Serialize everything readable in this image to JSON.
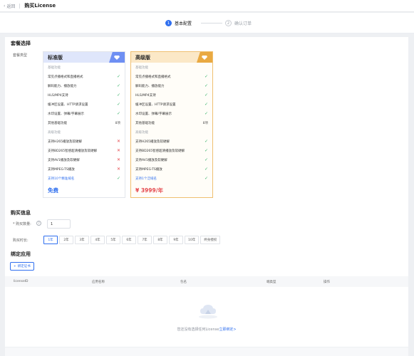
{
  "header": {
    "back": "返回",
    "title": "购买License"
  },
  "steps": [
    {
      "num": "1",
      "label": "基本配置"
    },
    {
      "num": "2",
      "label": "确认订单"
    }
  ],
  "package": {
    "section_title": "套餐选择",
    "type_label": "套餐类型",
    "cards": [
      {
        "name": "标准版",
        "features": [
          {
            "text": "基础功能",
            "group": true
          },
          {
            "text": "常见点播格式和直播格式",
            "mark": "check"
          },
          {
            "text": "解码能力、播放能力",
            "mark": "check"
          },
          {
            "text": "HLS/MP4支持",
            "mark": "check"
          },
          {
            "text": "缓冲区设置、HTTP请求设置",
            "mark": "check"
          },
          {
            "text": "水印设置、弹幕/字幕展示",
            "mark": "check"
          },
          {
            "text": "其他基础功能",
            "mark": "count",
            "count": "8项"
          },
          {
            "text": "高级功能",
            "group": true
          },
          {
            "text": "支持H265播放及软硬解",
            "mark": "cross"
          },
          {
            "text": "支持BD265智感超清播放及软硬解",
            "mark": "cross"
          },
          {
            "text": "支持AV1播放及软硬解",
            "mark": "cross"
          },
          {
            "text": "支持MPEG-TS播放",
            "mark": "cross"
          },
          {
            "text": "支持10个精准域名",
            "mark": "check",
            "domain": true
          }
        ],
        "price": "免费"
      },
      {
        "name": "高级版",
        "features": [
          {
            "text": "基础功能",
            "group": true
          },
          {
            "text": "常见点播格式和直播格式",
            "mark": "check"
          },
          {
            "text": "解码能力、播放能力",
            "mark": "check"
          },
          {
            "text": "HLS/MP4支持",
            "mark": "check"
          },
          {
            "text": "缓冲区设置、HTTP请求设置",
            "mark": "check"
          },
          {
            "text": "水印设置、弹幕/字幕展示",
            "mark": "check"
          },
          {
            "text": "其他基础功能",
            "mark": "count",
            "count": "8项"
          },
          {
            "text": "高级功能",
            "group": true
          },
          {
            "text": "支持H265播放及软硬解",
            "mark": "check"
          },
          {
            "text": "支持BD265智感超清播放及软硬解",
            "mark": "check"
          },
          {
            "text": "支持AV1播放及软硬解",
            "mark": "check"
          },
          {
            "text": "支持MPEG-TS播放",
            "mark": "check"
          },
          {
            "text": "支持1个泛域名",
            "mark": "check",
            "domain": true
          }
        ],
        "price": "¥ 3999/年"
      }
    ]
  },
  "purchase": {
    "section_title": "购买信息",
    "qty_label": "* 购买数量:",
    "qty_value": "1",
    "period_label": "购买时长:",
    "periods": [
      "1年",
      "2年",
      "3年",
      "4年",
      "5年",
      "6年",
      "7年",
      "8年",
      "9年",
      "10年",
      "终身授权"
    ],
    "selected_period": 0
  },
  "binding": {
    "section_title": "绑定应用",
    "bind_button": "绑定证书",
    "columns": [
      "licenseID",
      "应用名称",
      "包名",
      "端类型",
      "操作"
    ],
    "empty_text": "您还没有选择任何License",
    "empty_link": "立即绑定>"
  },
  "colors": {
    "accent": "#2f6fef",
    "check": "#3bb36b",
    "cross": "#e5484d",
    "premium": "#e9a942"
  }
}
